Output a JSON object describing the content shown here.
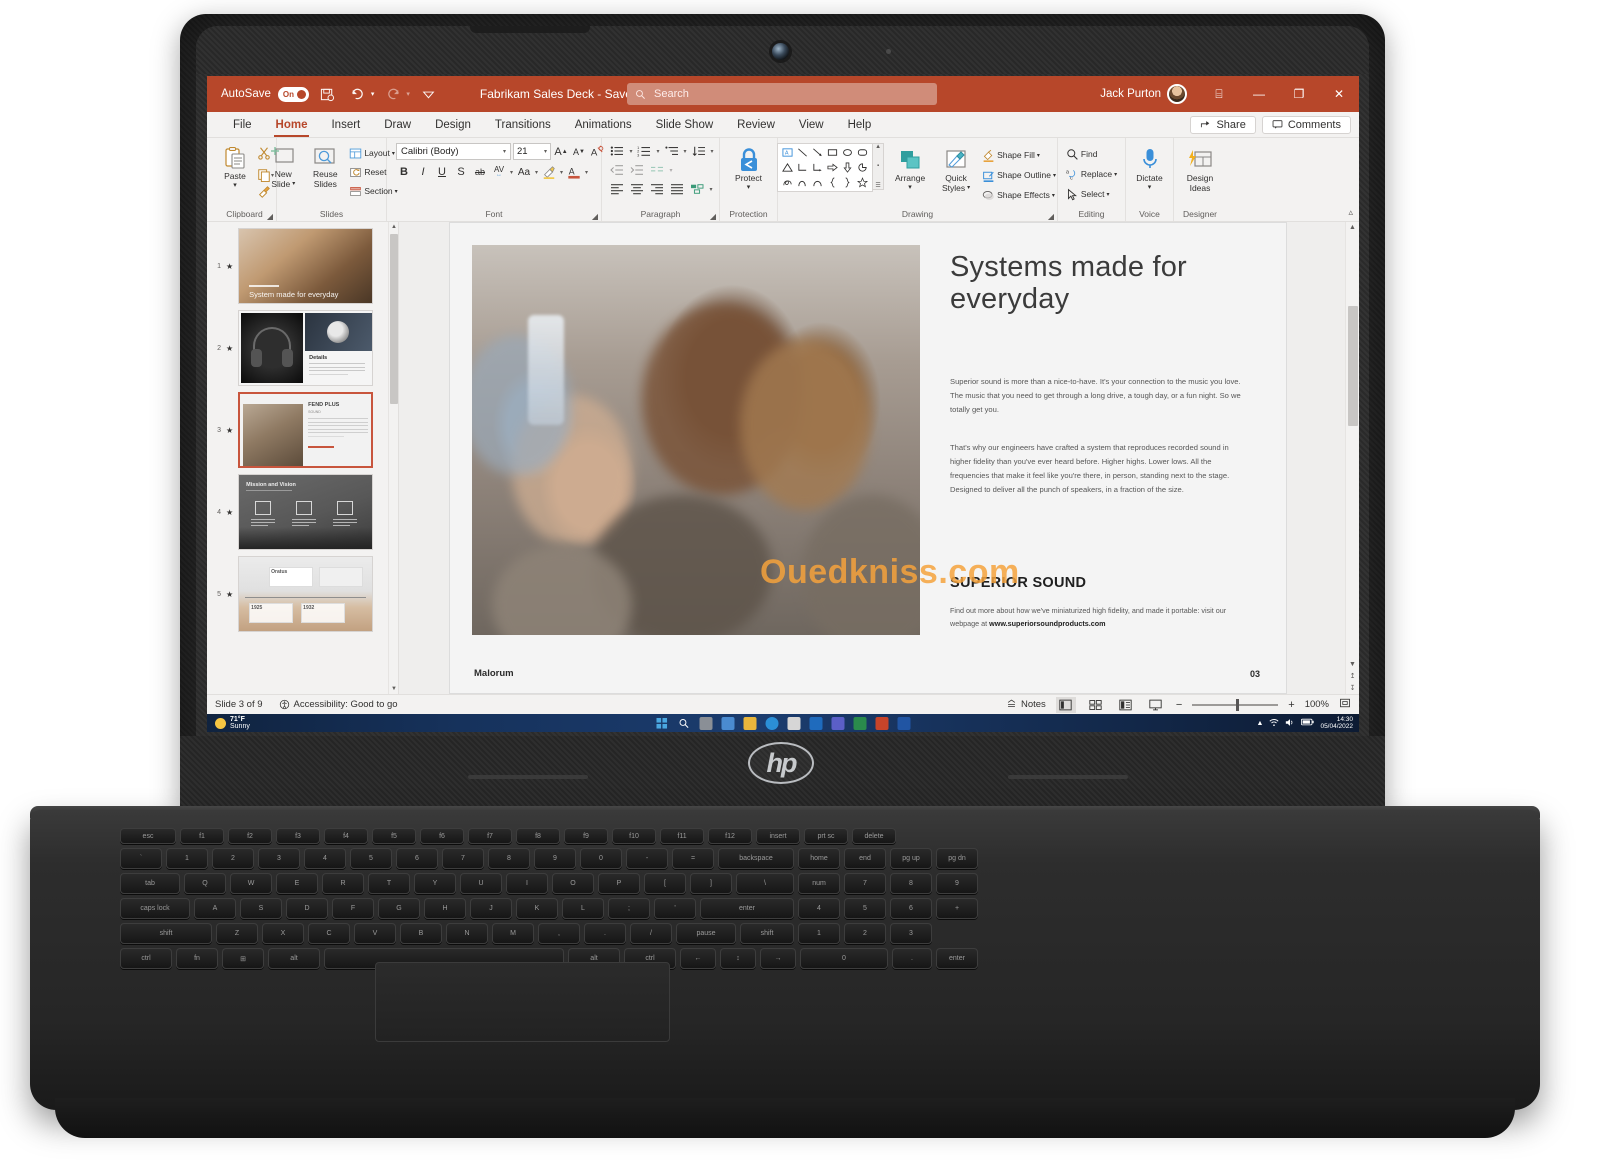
{
  "window": {
    "autosave_label": "AutoSave",
    "autosave_state": "On",
    "doc_title": "Fabrikam Sales Deck  -  Saved",
    "search_placeholder": "Search",
    "user_name": "Jack Purton",
    "minimize_label": "—",
    "restore_label": "❐",
    "close_label": "✕",
    "ribbon_display_label": "⌸"
  },
  "tabs": [
    {
      "label": "File",
      "active": false
    },
    {
      "label": "Home",
      "active": true
    },
    {
      "label": "Insert",
      "active": false
    },
    {
      "label": "Draw",
      "active": false
    },
    {
      "label": "Design",
      "active": false
    },
    {
      "label": "Transitions",
      "active": false
    },
    {
      "label": "Animations",
      "active": false
    },
    {
      "label": "Slide Show",
      "active": false
    },
    {
      "label": "Review",
      "active": false
    },
    {
      "label": "View",
      "active": false
    },
    {
      "label": "Help",
      "active": false
    }
  ],
  "tabs_right": {
    "share_label": "Share",
    "comments_label": "Comments"
  },
  "ribbon": {
    "groups": [
      {
        "label": "Clipboard"
      },
      {
        "label": "Slides"
      },
      {
        "label": "Font"
      },
      {
        "label": "Paragraph"
      },
      {
        "label": "Protection"
      },
      {
        "label": "Drawing"
      },
      {
        "label": "Editing"
      },
      {
        "label": "Voice"
      },
      {
        "label": "Designer"
      }
    ],
    "clipboard": {
      "paste_label": "Paste"
    },
    "slides": {
      "new_slide_label": "New\nSlide",
      "new_slide_line1": "New",
      "new_slide_line2": "Slide",
      "reuse_line1": "Reuse",
      "reuse_line2": "Slides",
      "layout_label": "Layout",
      "reset_label": "Reset",
      "section_label": "Section"
    },
    "font": {
      "font_name": "Calibri (Body)",
      "font_size": "21",
      "grow_label": "A",
      "shrink_label": "A",
      "bold_label": "B",
      "italic_label": "I",
      "underline_label": "U",
      "shadow_label": "S",
      "strike_label": "ab",
      "spacing_label": "AV",
      "case_label": "Aa",
      "clear_label": "A"
    },
    "protection": {
      "protect_label": "Protect"
    },
    "drawing": {
      "arrange_label": "Arrange",
      "quick_styles_line1": "Quick",
      "quick_styles_line2": "Styles",
      "shape_fill_label": "Shape Fill",
      "shape_outline_label": "Shape Outline",
      "shape_effects_label": "Shape Effects"
    },
    "editing": {
      "find_label": "Find",
      "replace_label": "Replace",
      "select_label": "Select"
    },
    "voice": {
      "dictate_label": "Dictate"
    },
    "designer": {
      "design_ideas_line1": "Design",
      "design_ideas_line2": "Ideas"
    }
  },
  "thumbnails": [
    {
      "number": "1",
      "title": "System made for everyday",
      "selected": false
    },
    {
      "number": "2",
      "title": "Details",
      "selected": false
    },
    {
      "number": "3",
      "title": "FEND PLUS",
      "selected": true
    },
    {
      "number": "4",
      "title": "Mission and Vision",
      "selected": false
    },
    {
      "number": "5",
      "title": "Oratus",
      "selected": false
    }
  ],
  "slide": {
    "title": "Systems made for everyday",
    "paragraph1": "Superior sound is more than a nice-to-have. It's your connection to the music you love. The music that you need to get through a long drive, a tough day, or a fun night. So we totally get you.",
    "paragraph2": "That's why our engineers have crafted a system that reproduces recorded sound in higher fidelity than you've ever heard before. Higher highs. Lower lows. All the frequencies that make it feel like you're there, in person, standing next to the stage. Designed to deliver all the punch of speakers, in a fraction of the size.",
    "heading2": "SUPERIOR SOUND",
    "footer_text_1": "Find out more about how we've miniaturized high fidelity, and made it portable:",
    "footer_text_2": "visit our webpage at ",
    "footer_link": "www.superiorsoundproducts.com",
    "bottom_left_label": "Malorum",
    "page_number": "03",
    "watermark": "Ouedkniss.com"
  },
  "statusbar": {
    "slide_count": "Slide 3 of 9",
    "accessibility": "Accessibility: Good to go",
    "notes_label": "Notes",
    "zoom_level": "100%",
    "zoom_out_label": "−",
    "zoom_in_label": "+"
  },
  "taskbar": {
    "weather_temp": "71°F",
    "weather_cond": "Sunny",
    "clock_time": "14:30",
    "clock_date": "05/04/2022"
  },
  "hardware": {
    "brand": "hp"
  },
  "colors": {
    "accent": "#b7472a",
    "selected_thumb": "#c8553d",
    "watermark": "#f4a23c"
  }
}
